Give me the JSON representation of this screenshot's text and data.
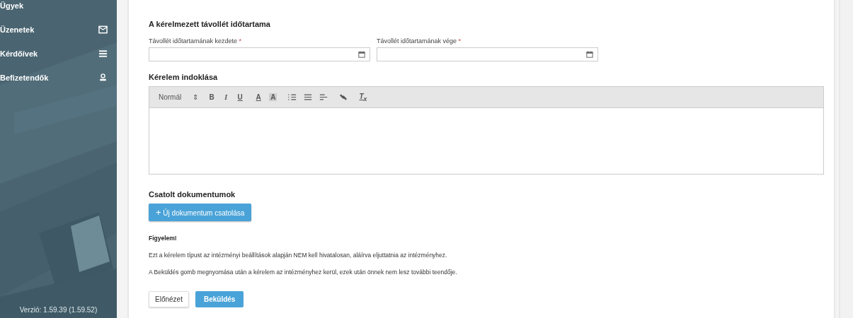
{
  "sidebar": {
    "items": [
      {
        "label": "Ügyek"
      },
      {
        "label": "Üzenetek"
      },
      {
        "label": "Kérdőívek"
      },
      {
        "label": "Befizetendők"
      }
    ],
    "version": "Verzió: 1.59.39 (1.59.52)"
  },
  "form": {
    "title": "A kérelmezett távollét időtartama",
    "fields": [
      {
        "label": "Távollét időtartamának kezdete",
        "required": true,
        "required_mark": "*"
      },
      {
        "label": "Távollét időtartamának vége",
        "required": true,
        "required_mark": "*"
      }
    ],
    "reason_title": "Kérelem indoklása",
    "toolbar": {
      "format": "Normál",
      "format_arrows": "⇕",
      "marks": [
        "B",
        "I",
        "U"
      ],
      "colors": [
        "A",
        "A"
      ],
      "clear": "T$_{x}$"
    },
    "attachments_title": "Csatolt dokumentumok",
    "attach_button": {
      "icon": "+",
      "label": "Új dokumentum csatolása"
    },
    "notice_title": "Figyelem!",
    "notice_lines": [
      "Ezt a kérelem típust az intézményi beállítások alapján NEM kell hivatalosan, aláírva eljuttatnia az intézményhez.",
      "A Beküldés gomb megnyomása után a kérelem az intézményhez kerül, ezek után önnek nem lesz további teendője."
    ],
    "buttons": [
      {
        "label": "Előnézet",
        "kind": "secondary"
      },
      {
        "label": "Beküldés",
        "kind": "primary"
      }
    ]
  }
}
